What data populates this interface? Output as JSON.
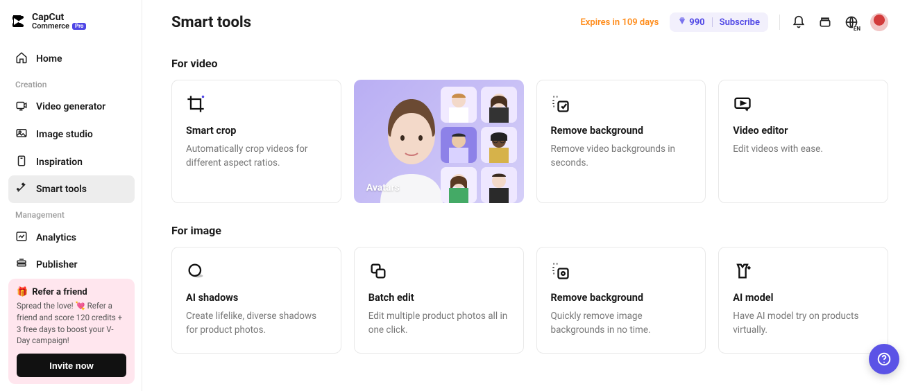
{
  "brand": {
    "line1": "CapCut",
    "line2": "Commerce",
    "badge": "Pro"
  },
  "nav": {
    "home": "Home",
    "section_creation": "Creation",
    "video_generator": "Video generator",
    "image_studio": "Image studio",
    "inspiration": "Inspiration",
    "smart_tools": "Smart tools",
    "section_management": "Management",
    "analytics": "Analytics",
    "publisher": "Publisher"
  },
  "invite": {
    "title": "Refer a friend",
    "desc_before_heart": "Spread the love! ",
    "desc_after_heart": " Refer a friend and score 120 credits + 3 free days to boost your V-Day campaign!",
    "button": "Invite now"
  },
  "header": {
    "title": "Smart tools",
    "expires": "Expires in 109 days",
    "credits": "990",
    "subscribe": "Subscribe",
    "lang_code": "EN"
  },
  "sections": {
    "video": {
      "title": "For video",
      "cards": [
        {
          "title": "Smart crop",
          "desc": "Automatically crop videos for different aspect ratios."
        },
        {
          "promo_label": "Avatars"
        },
        {
          "title": "Remove background",
          "desc": "Remove video backgrounds in seconds."
        },
        {
          "title": "Video editor",
          "desc": "Edit videos with ease."
        }
      ]
    },
    "image": {
      "title": "For image",
      "cards": [
        {
          "title": "AI shadows",
          "desc": "Create lifelike, diverse shadows for product photos."
        },
        {
          "title": "Batch edit",
          "desc": "Edit multiple product photos all in one click."
        },
        {
          "title": "Remove background",
          "desc": "Quickly remove image backgrounds in no time."
        },
        {
          "title": "AI model",
          "desc": "Have AI model try on products virtually."
        }
      ]
    }
  }
}
